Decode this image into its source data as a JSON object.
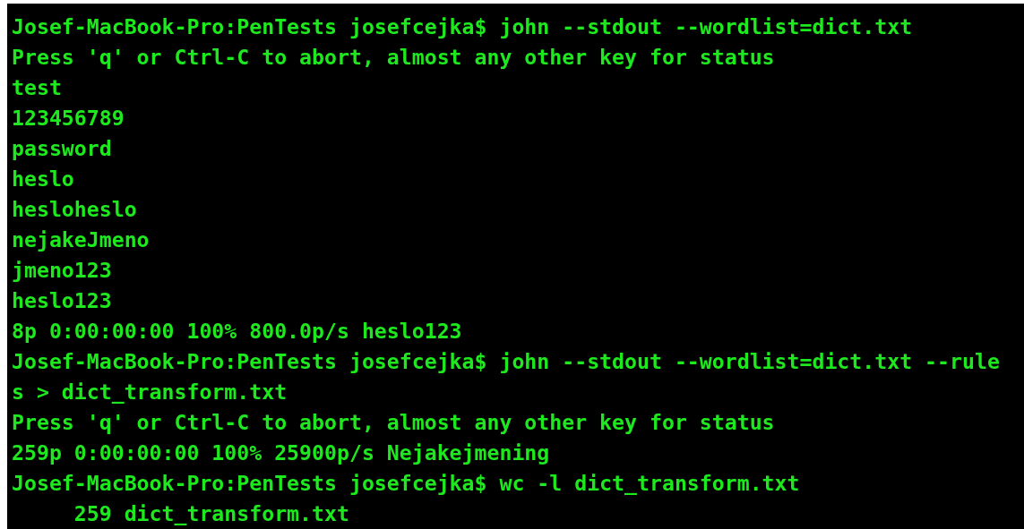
{
  "terminal": {
    "lines": [
      "Josef-MacBook-Pro:PenTests josefcejka$ john --stdout --wordlist=dict.txt",
      "Press 'q' or Ctrl-C to abort, almost any other key for status",
      "test",
      "123456789",
      "password",
      "heslo",
      "hesloheslo",
      "nejakeJmeno",
      "jmeno123",
      "heslo123",
      "8p 0:00:00:00 100% 800.0p/s heslo123",
      "Josef-MacBook-Pro:PenTests josefcejka$ john --stdout --wordlist=dict.txt --rule",
      "s > dict_transform.txt",
      "Press 'q' or Ctrl-C to abort, almost any other key for status",
      "259p 0:00:00:00 100% 25900p/s Nejakejmening",
      "Josef-MacBook-Pro:PenTests josefcejka$ wc -l dict_transform.txt",
      "     259 dict_transform.txt"
    ]
  }
}
